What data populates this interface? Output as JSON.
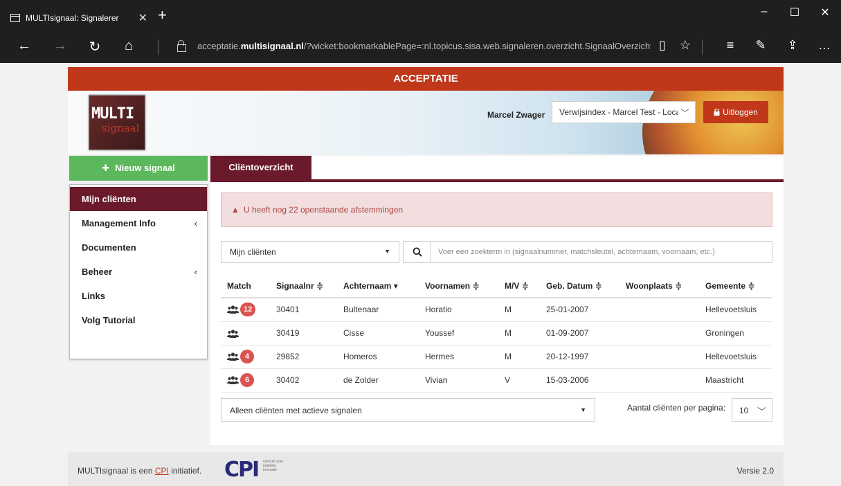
{
  "browser": {
    "tab_title": "MULTIsignaal: Signalerer",
    "url_prefix": "acceptatie.",
    "url_domain": "multisignaal.nl",
    "url_rest": "/?wicket:bookmarkablePage=:nl.topicus.sisa.web.signaleren.overzicht.SignaalOverzicht"
  },
  "banner": {
    "text": "ACCEPTATIE"
  },
  "logo": {
    "line1": "MULTI",
    "line2": "signaal"
  },
  "header": {
    "user_name": "Marcel Zwager",
    "ref_select": "Verwijsindex - Marcel Test - Locatie",
    "logout_label": "Uitloggen"
  },
  "new_signal_label": "Nieuw signaal",
  "sidebar": {
    "items": [
      {
        "label": "Mijn cliënten",
        "active": true
      },
      {
        "label": "Management Info",
        "has_submenu": true
      },
      {
        "label": "Documenten"
      },
      {
        "label": "Beheer",
        "has_submenu": true
      },
      {
        "label": "Links"
      },
      {
        "label": "Volg Tutorial"
      }
    ]
  },
  "page_tab": "Cliëntoverzicht",
  "alert": {
    "text": "U heeft nog 22 openstaande afstemmingen"
  },
  "filter": {
    "value": "Mijn cliënten"
  },
  "search": {
    "placeholder": "Voer een zoekterm in (signaalnummer, matchsleutel, achternaam, voornaam, etc.)"
  },
  "table": {
    "headers": [
      "Match",
      "Signaalnr ≑",
      "Achternaam ▾",
      "Voornamen ≑",
      "M/V ≑",
      "Geb. Datum ≑",
      "Woonplaats ≑",
      "Gemeente ≑"
    ],
    "rows": [
      {
        "badge": "12",
        "signaalnr": "30401",
        "achternaam": "Bultenaar",
        "voornamen": "Horatio",
        "mv": "M",
        "geb": "25-01-2007",
        "woonplaats": "",
        "gemeente": "Hellevoetsluis"
      },
      {
        "badge": "",
        "signaalnr": "30419",
        "achternaam": "Cisse",
        "voornamen": "Youssef",
        "mv": "M",
        "geb": "01-09-2007",
        "woonplaats": "",
        "gemeente": "Groningen"
      },
      {
        "badge": "4",
        "signaalnr": "29852",
        "achternaam": "Homeros",
        "voornamen": "Hermes",
        "mv": "M",
        "geb": "20-12-1997",
        "woonplaats": "",
        "gemeente": "Hellevoetsluis"
      },
      {
        "badge": "6",
        "signaalnr": "30402",
        "achternaam": "de Zolder",
        "voornamen": "Vivian",
        "mv": "V",
        "geb": "15-03-2006",
        "woonplaats": "",
        "gemeente": "Maastricht"
      }
    ]
  },
  "active_filter": {
    "value": "Alleen cliënten met actieve signalen"
  },
  "per_page": {
    "label": "Aantal cliënten per pagina:",
    "value": "10"
  },
  "footer": {
    "text_before": "MULTIsignaal is een",
    "link": "CPI",
    "text_after": "initiatief.",
    "cpi_logo": "CPI",
    "cpi_sub": "centrum voor publieke innovatie",
    "version": "Versie 2.0"
  }
}
